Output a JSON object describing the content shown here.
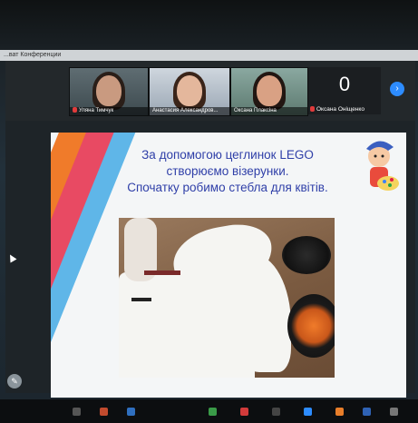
{
  "window": {
    "title": "...ват Конференции"
  },
  "participants": [
    {
      "name": "Уляна Тимчук",
      "muted": true
    },
    {
      "name": "Анастасия Александров...",
      "muted": false
    },
    {
      "name": "Оксана Плаксіна",
      "muted": false
    },
    {
      "name": "Оксана Оніщенко",
      "muted": true
    }
  ],
  "hidden_count": "0",
  "next_button": "›",
  "slide": {
    "title_line1": "За допомогою цеглинок LEGO",
    "title_line2": "створюємо візерунки.",
    "title_line3": "Спочатку робимо стебла для квітів."
  },
  "colors": {
    "slide_title": "#2f3fa8",
    "stripe_orange": "#f07b2a",
    "stripe_red": "#e84a63",
    "stripe_blue": "#5fb6e8",
    "zoom_blue": "#2d8cff"
  },
  "icons": [
    "pencil-icon",
    "chevron-right-icon",
    "mic-muted-icon",
    "cursor-icon"
  ]
}
